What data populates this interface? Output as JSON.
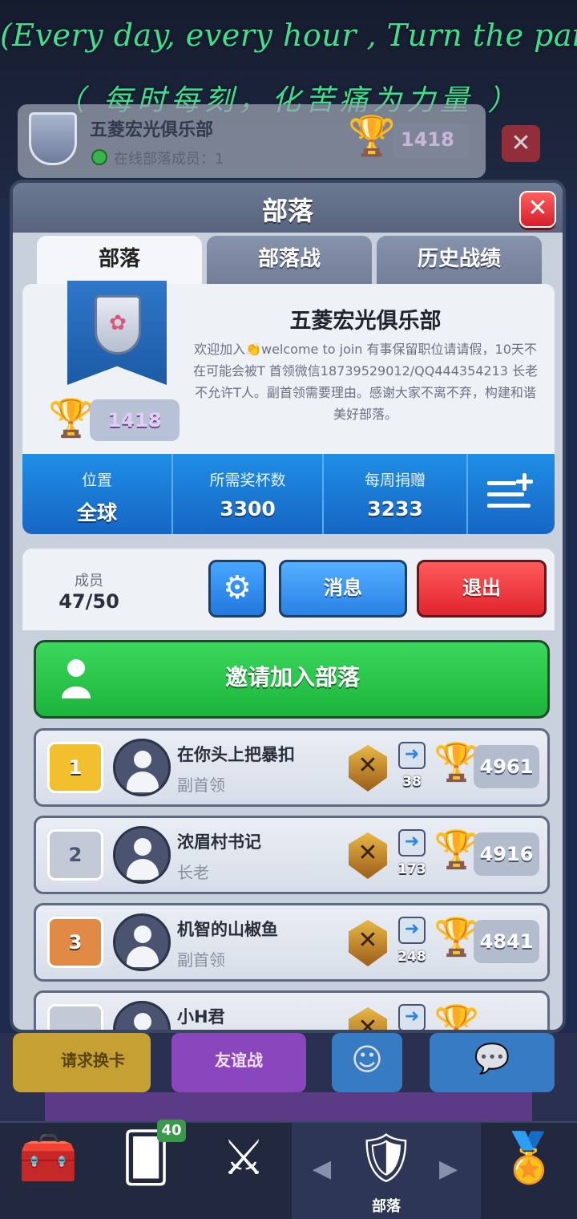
{
  "overlay": {
    "line1": "(Every day, every hour , Turn the pai",
    "line2": "（ 每时每刻，化苦痛为力量 ）"
  },
  "background": {
    "clan_name": "五菱宏光俱乐部",
    "online_text": "在线部落成员：1",
    "trophies": "1418"
  },
  "dialog": {
    "title": "部落",
    "close_icon": "close-icon"
  },
  "tabs": [
    {
      "label": "部落",
      "active": true
    },
    {
      "label": "部落战",
      "active": false
    },
    {
      "label": "历史战绩",
      "active": false
    }
  ],
  "clan": {
    "name": "五菱宏光俱乐部",
    "description": "欢迎加入👏welcome to join 有事保留职位请请假，10天不在可能会被T 首领微信18739529012/QQ444354213 长老不允许T人。副首领需要理由。感谢大家不离不弃，构建和谐美好部落。",
    "trophies": "1418",
    "badge_icon": "sakura-badge-icon"
  },
  "stats": {
    "location_label": "位置",
    "location_value": "全球",
    "required_label": "所需奖杯数",
    "required_value": "3300",
    "donation_label": "每周捐赠",
    "donation_value": "3233",
    "filter_icon": "sort-add-icon"
  },
  "members": {
    "label": "成员",
    "count": "47/50",
    "settings_icon": "gear-icon",
    "message_label": "消息",
    "exit_label": "退出",
    "invite_label": "邀请加入部落"
  },
  "member_list": [
    {
      "rank": "1",
      "name": "在你头上把暴扣",
      "role": "副首领",
      "donations": "38",
      "trophies": "4961",
      "rank_color": "#f2c02e"
    },
    {
      "rank": "2",
      "name": "浓眉村书记",
      "role": "长老",
      "donations": "173",
      "trophies": "4916",
      "rank_color": "#c3cad6"
    },
    {
      "rank": "3",
      "name": "机智的山椒鱼",
      "role": "副首领",
      "donations": "248",
      "trophies": "4841",
      "rank_color": "#e08a45"
    },
    {
      "rank": "",
      "name": "小H君",
      "role": "",
      "donations": "",
      "trophies": "",
      "rank_color": "#c3cad6"
    }
  ],
  "bottom": {
    "request_label": "请求换卡",
    "friendly_label": "友谊战",
    "cards_badge": "40",
    "clan_label": "部落"
  },
  "colors": {
    "accent_blue": "#1f8ee6",
    "invite_green": "#1cb43c",
    "exit_red": "#e0252d"
  }
}
